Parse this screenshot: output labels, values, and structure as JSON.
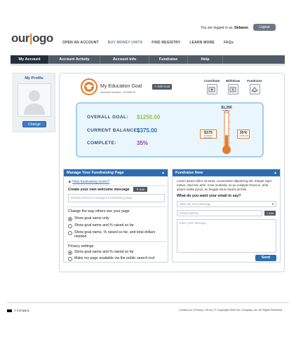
{
  "header": {
    "logo_part1": "our",
    "logo_bar": "|",
    "logo_part2": "ogo",
    "logged_in_prefix": "You are logged in as:",
    "username": "Debaser.",
    "logout_label": "Logout",
    "topnav": [
      "OPEN AN ACCOUNT",
      "BUY MONEY UNITS",
      "FIND REGISTRY",
      "LEARN MORE",
      "FAQs"
    ]
  },
  "mainnav": {
    "tabs": [
      "My Account",
      "Account Activity",
      "Account Info",
      "Fundraise",
      "Help"
    ]
  },
  "sidebar": {
    "title": "My Profile",
    "change_label": "Change"
  },
  "goal": {
    "title": "My Education Goal",
    "account_number": "Account Number: 12345678",
    "edit_label": "Edit Goal",
    "actions": [
      "Contribute",
      "Withdraw",
      "Fundraise"
    ],
    "overall_label": "OVERALL GOAL:",
    "overall_value": "$1250.00",
    "balance_label": "CURRENT BALANCE:",
    "balance_value": "$375.00",
    "complete_label": "COMPLETE:",
    "complete_value": "35%",
    "thermo_goal": "$1,250",
    "thermo_goal_sub": "OVERALL GOAL",
    "thermo_balance": "$375",
    "thermo_balance_sub": "CURRENT BALANCE",
    "thermo_percent": "35%",
    "thermo_percent_sub": "COMPLETE",
    "fill_fraction": 0.35,
    "colors": {
      "overall": "#8cc63f",
      "balance": "#2c6cb3",
      "complete": "#9b3ea3",
      "accent": "#e57b2c"
    }
  },
  "manage": {
    "title": "Manage Your Fundraising Page",
    "link": "How fundraising works?",
    "welcome_heading": "Create your own welcome message",
    "edit_label": "Edit",
    "welcome_placeholder": "Default welcome message for fundraising page",
    "display_heading": "Change the way others see your page",
    "display_options": [
      "Show goal name only",
      "Show goal name and % raised so far",
      "Show goal name, % raised so far, and total dollars needed"
    ],
    "privacy_heading": "Privacy settings",
    "privacy_options": [
      "Show goal name and % raised so far",
      "Make my page available via the public search tool"
    ]
  },
  "fundraise": {
    "title": "Fundraise Now",
    "lorem": "Lorem ipsum dolor sit amet, consectetur adipiscing elit. Integer eget metus. Sed nec ante. Cras molestie, ex eu volutpat rhoncus, ante ipsum mollis purus, ac feugiat risus mauris at felis.",
    "question": "What do you want your email to say?",
    "select_placeholder": "Write My Own Message",
    "email_placeholder": "Email Address",
    "add_label": "Add",
    "message_placeholder": "Enter your message...",
    "send_label": "Send"
  },
  "footer": {
    "company": "A Company",
    "links": "Contact Us  |  Privacy  |  Terms  |  © Copyright 2008 Our Company, Inc. All Rights Reserved."
  }
}
